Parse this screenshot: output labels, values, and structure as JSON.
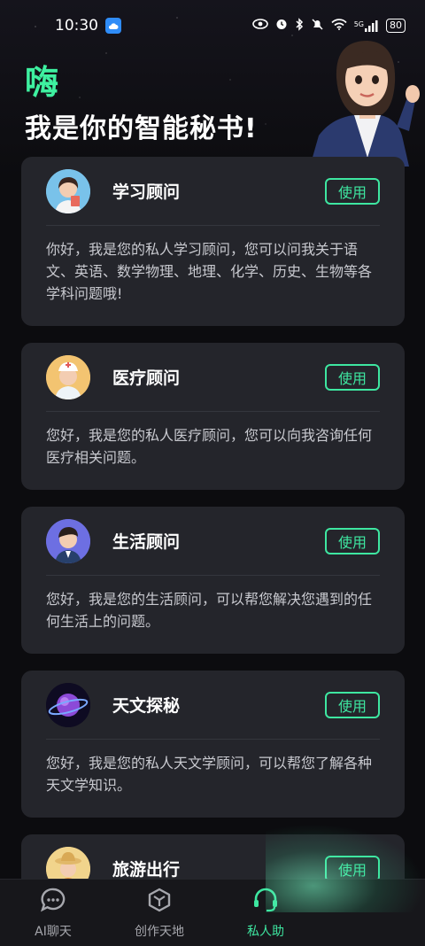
{
  "status_bar": {
    "time": "10:30",
    "network": "5G",
    "battery": "80"
  },
  "header": {
    "hi": "嗨",
    "subtitle": "我是你的智能秘书!"
  },
  "cards": [
    {
      "title": "学习顾问",
      "button": "使用",
      "desc": "你好，我是您的私人学习顾问，您可以问我关于语文、英语、数学物理、地理、化学、历史、生物等各学科问题哦!"
    },
    {
      "title": "医疗顾问",
      "button": "使用",
      "desc": "您好，我是您的私人医疗顾问，您可以向我咨询任何医疗相关问题。"
    },
    {
      "title": "生活顾问",
      "button": "使用",
      "desc": "您好，我是您的生活顾问，可以帮您解决您遇到的任何生活上的问题。"
    },
    {
      "title": "天文探秘",
      "button": "使用",
      "desc": "您好，我是您的私人天文学顾问，可以帮您了解各种天文学知识。"
    },
    {
      "title": "旅游出行",
      "button": "使用",
      "desc": ""
    }
  ],
  "bottom_nav": [
    {
      "label": "AI聊天",
      "icon": "chat-bubble-icon"
    },
    {
      "label": "创作天地",
      "icon": "cube-icon"
    },
    {
      "label": "私人助",
      "icon": "headset-icon",
      "active": true
    }
  ],
  "colors": {
    "accent": "#3ee7a1",
    "card": "#24252b",
    "background": "#0c0c0f"
  }
}
